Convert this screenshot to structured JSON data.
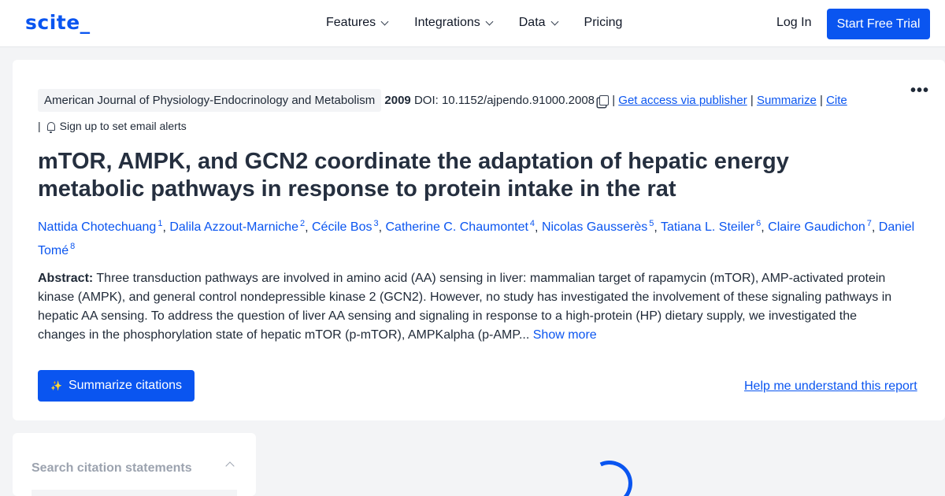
{
  "header": {
    "logo": "scite_",
    "nav": [
      {
        "label": "Features"
      },
      {
        "label": "Integrations"
      },
      {
        "label": "Data"
      },
      {
        "label": "Pricing"
      }
    ],
    "login": "Log In",
    "trial": "Start Free Trial"
  },
  "article": {
    "journal": "American Journal of Physiology-Endocrinology and Metabolism",
    "year": "2009",
    "doi": "DOI: 10.1152/ajpendo.91000.2008",
    "access": "Get access via publisher",
    "summarize_link": "Summarize",
    "cite": "Cite",
    "alerts": "Sign up to set email alerts",
    "title": "mTOR, AMPK, and GCN2 coordinate the adaptation of hepatic energy metabolic pathways in response to protein intake in the rat",
    "authors": [
      {
        "name": "Nattida Chotechuang",
        "sup": "1"
      },
      {
        "name": "Dalila Azzout-Marniche",
        "sup": "2"
      },
      {
        "name": "Cécile Bos",
        "sup": "3"
      },
      {
        "name": "Catherine C. Chaumontet",
        "sup": "4"
      },
      {
        "name": "Nicolas Gausserès",
        "sup": "5"
      },
      {
        "name": "Tatiana L. Steiler",
        "sup": "6"
      },
      {
        "name": "Claire Gaudichon",
        "sup": "7"
      },
      {
        "name": "Daniel Tomé",
        "sup": "8"
      }
    ],
    "abstract_label": "Abstract:",
    "abstract": "Three transduction pathways are involved in amino acid (AA) sensing in liver: mammalian target of rapamycin (mTOR), AMP-activated protein kinase (AMPK), and general control nondepressible kinase 2 (GCN2). However, no study has investigated the involvement of these signaling pathways in hepatic AA sensing. To address the question of liver AA sensing and signaling in response to a high-protein (HP) dietary supply, we investigated the changes in the phosphorylation state of hepatic mTOR (p-mTOR), AMPKalpha (p-AMP...",
    "show_more": "Show more",
    "summarize_button": "Summarize citations",
    "help": "Help me understand this report"
  },
  "sidebar": {
    "search_label": "Search citation statements"
  }
}
